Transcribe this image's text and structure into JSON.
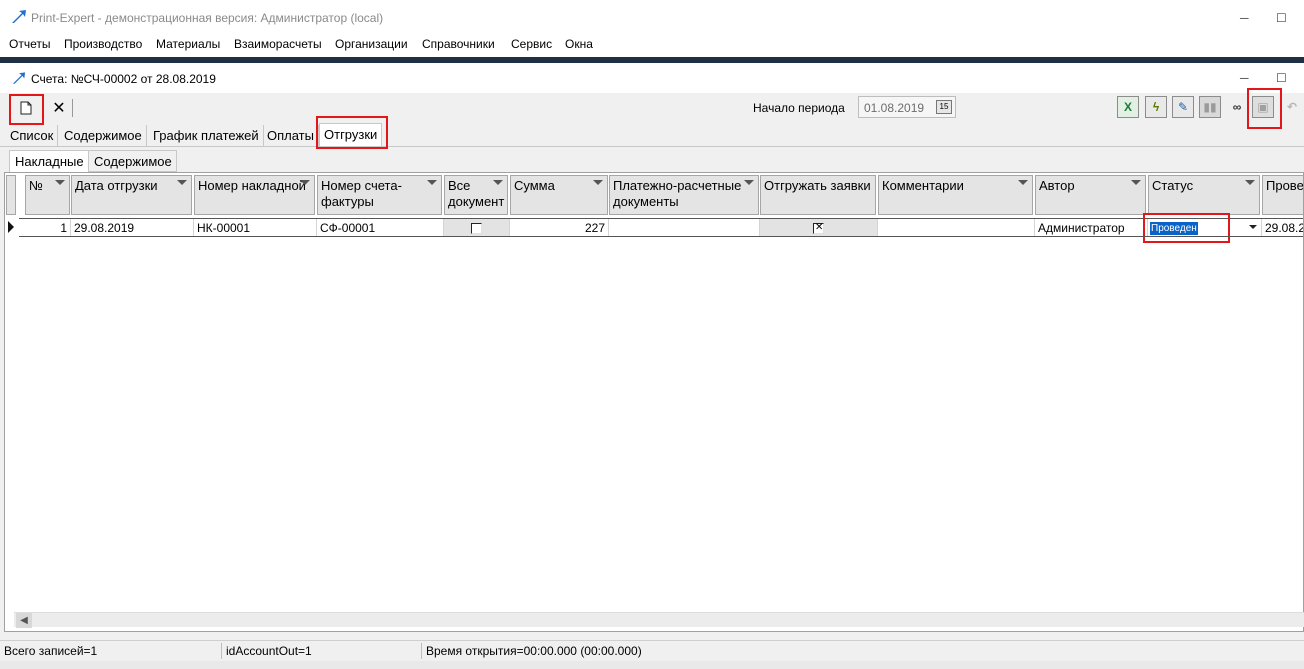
{
  "app": {
    "title": "Print-Expert - демонстрационная версия: Администратор (local)",
    "minimize": "─",
    "maximize": "☐",
    "menu": [
      "Отчеты",
      "Производство",
      "Материалы",
      "Взаиморасчеты",
      "Организации",
      "Справочники",
      "Сервис",
      "Окна"
    ]
  },
  "doc_window": {
    "title": "Счета: №СЧ-00002 от 28.08.2019",
    "minimize": "─",
    "maximize": "☐"
  },
  "toolbar": {
    "new_icon": "new-document-icon",
    "delete_icon": "close-icon",
    "period_label": "Начало периода",
    "period_value": "01.08.2019",
    "calendar_icon": "15",
    "right_icons": [
      "excel-icon",
      "lightning-icon",
      "edit-icon",
      "disabled-icon",
      "binoculars-icon",
      "save-icon",
      "undo-icon"
    ]
  },
  "tabs": [
    "Список",
    "Содержимое",
    "График платежей",
    "Оплаты",
    "Отгрузки"
  ],
  "active_tab": "Отгрузки",
  "subtabs": [
    "Накладные",
    "Содержимое"
  ],
  "active_subtab": "Накладные",
  "grid": {
    "columns": [
      {
        "key": "num",
        "label": "№"
      },
      {
        "key": "date",
        "label": "Дата отгрузки"
      },
      {
        "key": "invoice",
        "label": "Номер накладной"
      },
      {
        "key": "sf",
        "label": "Номер счета-фактуры"
      },
      {
        "key": "all",
        "label": "Все документ"
      },
      {
        "key": "sum",
        "label": "Сумма"
      },
      {
        "key": "paydocs",
        "label": "Платежно-расчетные документы"
      },
      {
        "key": "ship",
        "label": "Отгружать заявки"
      },
      {
        "key": "comment",
        "label": "Комментарии"
      },
      {
        "key": "author",
        "label": "Автор"
      },
      {
        "key": "status",
        "label": "Статус"
      },
      {
        "key": "posted",
        "label": "Провед"
      }
    ],
    "rows": [
      {
        "num": "1",
        "date": "29.08.2019",
        "invoice": "НК-00001",
        "sf": "СФ-00001",
        "all": false,
        "sum": "227",
        "paydocs": "",
        "ship": true,
        "comment": "",
        "author": "Администратор",
        "status": "Проведен",
        "posted": "29.08.2"
      }
    ]
  },
  "status": {
    "records": "Всего записей=1",
    "id": "idAccountOut=1",
    "time": "Время открытия=00:00.000 (00:00.000)"
  },
  "colors": {
    "highlight": "#e3171a",
    "selection": "#0a64c8",
    "separator": "#1f2f46"
  }
}
